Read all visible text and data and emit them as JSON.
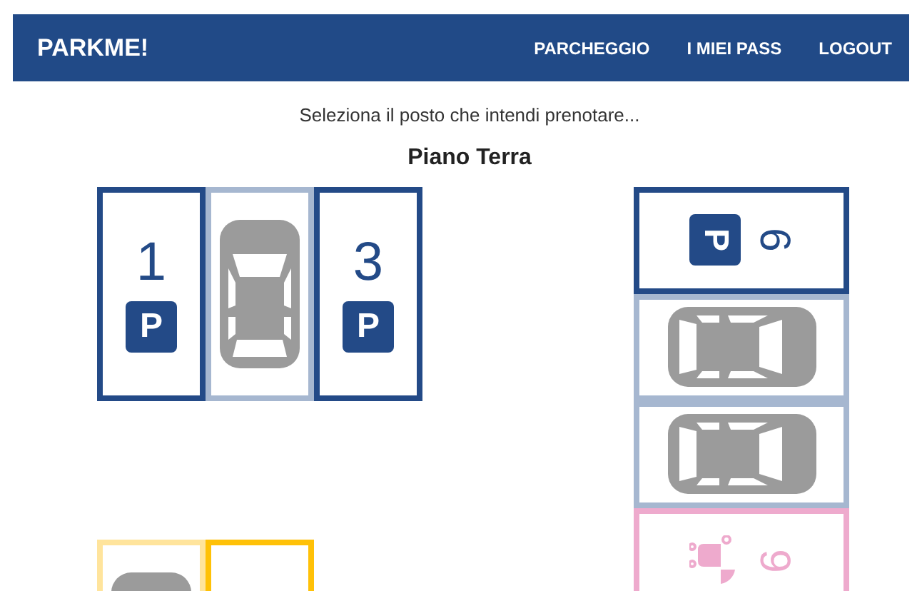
{
  "header": {
    "brand": "PARKME!",
    "nav": [
      "PARCHEGGIO",
      "I MIEI PASS",
      "LOGOUT"
    ]
  },
  "prompt": "Seleziona il posto che intendi prenotare...",
  "floor": "Piano Terra",
  "groups": [
    {
      "kind": "row",
      "slots": [
        {
          "kind": "standard",
          "occupied": false,
          "number": "1",
          "sign": "P"
        },
        {
          "kind": "standard",
          "occupied": true
        },
        {
          "kind": "standard",
          "occupied": false,
          "number": "3",
          "sign": "P"
        }
      ]
    },
    {
      "kind": "column",
      "slots": [
        {
          "kind": "standard",
          "occupied": false,
          "number": "6",
          "sign": "P"
        },
        {
          "kind": "standard",
          "occupied": true
        },
        {
          "kind": "standard",
          "occupied": true
        },
        {
          "kind": "family",
          "occupied": false,
          "number": "9"
        }
      ]
    },
    {
      "kind": "row",
      "slots": [
        {
          "kind": "reserved",
          "occupied": true
        },
        {
          "kind": "reserved",
          "occupied": false
        }
      ]
    }
  ]
}
